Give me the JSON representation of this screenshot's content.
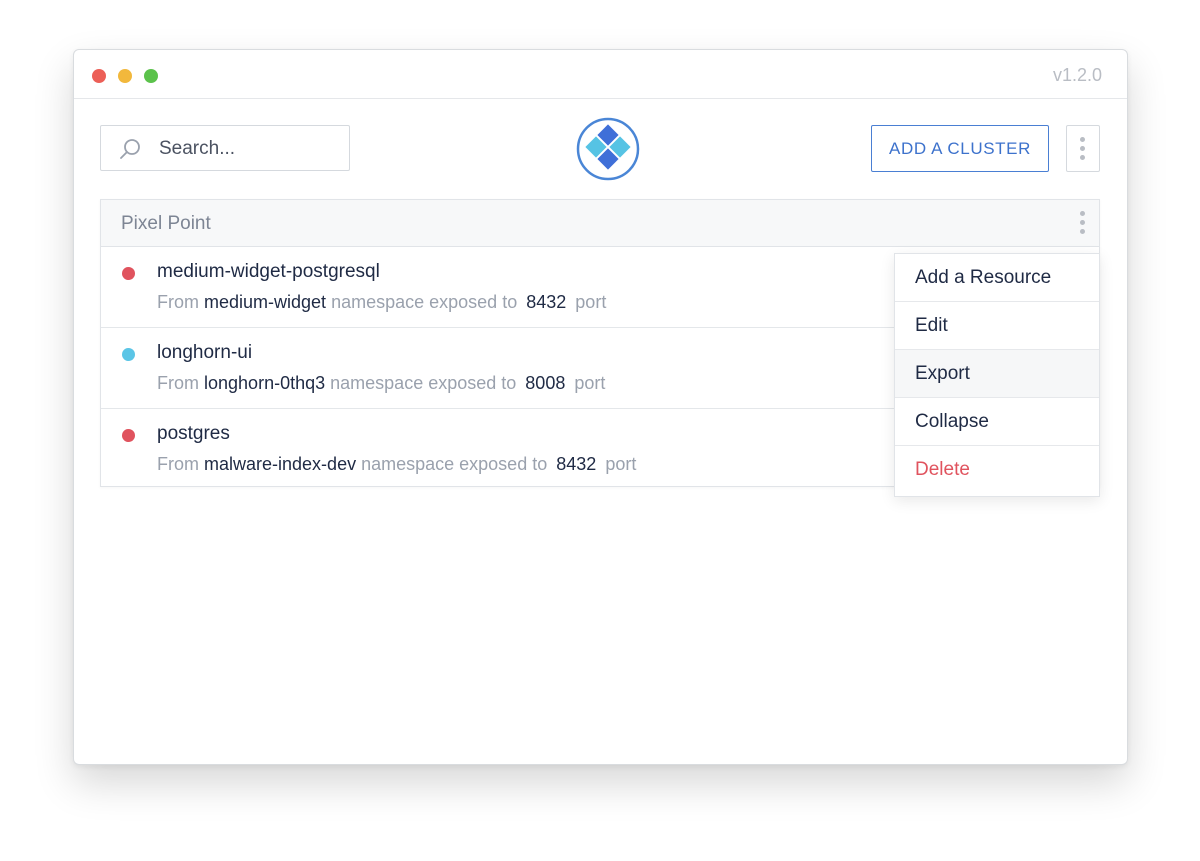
{
  "app": {
    "version": "v1.2.0",
    "traffic_lights": {
      "close": "#ec5f57",
      "minimize": "#f2b83c",
      "maximize": "#5bc24b"
    }
  },
  "toolbar": {
    "search_placeholder": "Search...",
    "add_cluster_label": "ADD A CLUSTER",
    "accent_color": "#3d72cc"
  },
  "cluster": {
    "name": "Pixel Point",
    "resources": [
      {
        "name": "medium-widget-postgresql",
        "status_color": "#e0535e",
        "from_label": "From",
        "namespace": "medium-widget",
        "exposed_label": "namespace exposed to",
        "port": "8432",
        "port_label": "port"
      },
      {
        "name": "longhorn-ui",
        "status_color": "#5bc5e6",
        "from_label": "From",
        "namespace": "longhorn-0thq3",
        "exposed_label": "namespace exposed to",
        "port": "8008",
        "port_label": "port"
      },
      {
        "name": "postgres",
        "status_color": "#e0535e",
        "from_label": "From",
        "namespace": "malware-index-dev",
        "exposed_label": "namespace exposed to",
        "port": "8432",
        "port_label": "port"
      }
    ]
  },
  "context_menu": {
    "items": [
      {
        "label": "Add a Resource"
      },
      {
        "label": "Edit"
      },
      {
        "label": "Export",
        "hovered": true
      },
      {
        "label": "Collapse"
      },
      {
        "label": "Delete",
        "color": "#e0535e"
      }
    ]
  }
}
